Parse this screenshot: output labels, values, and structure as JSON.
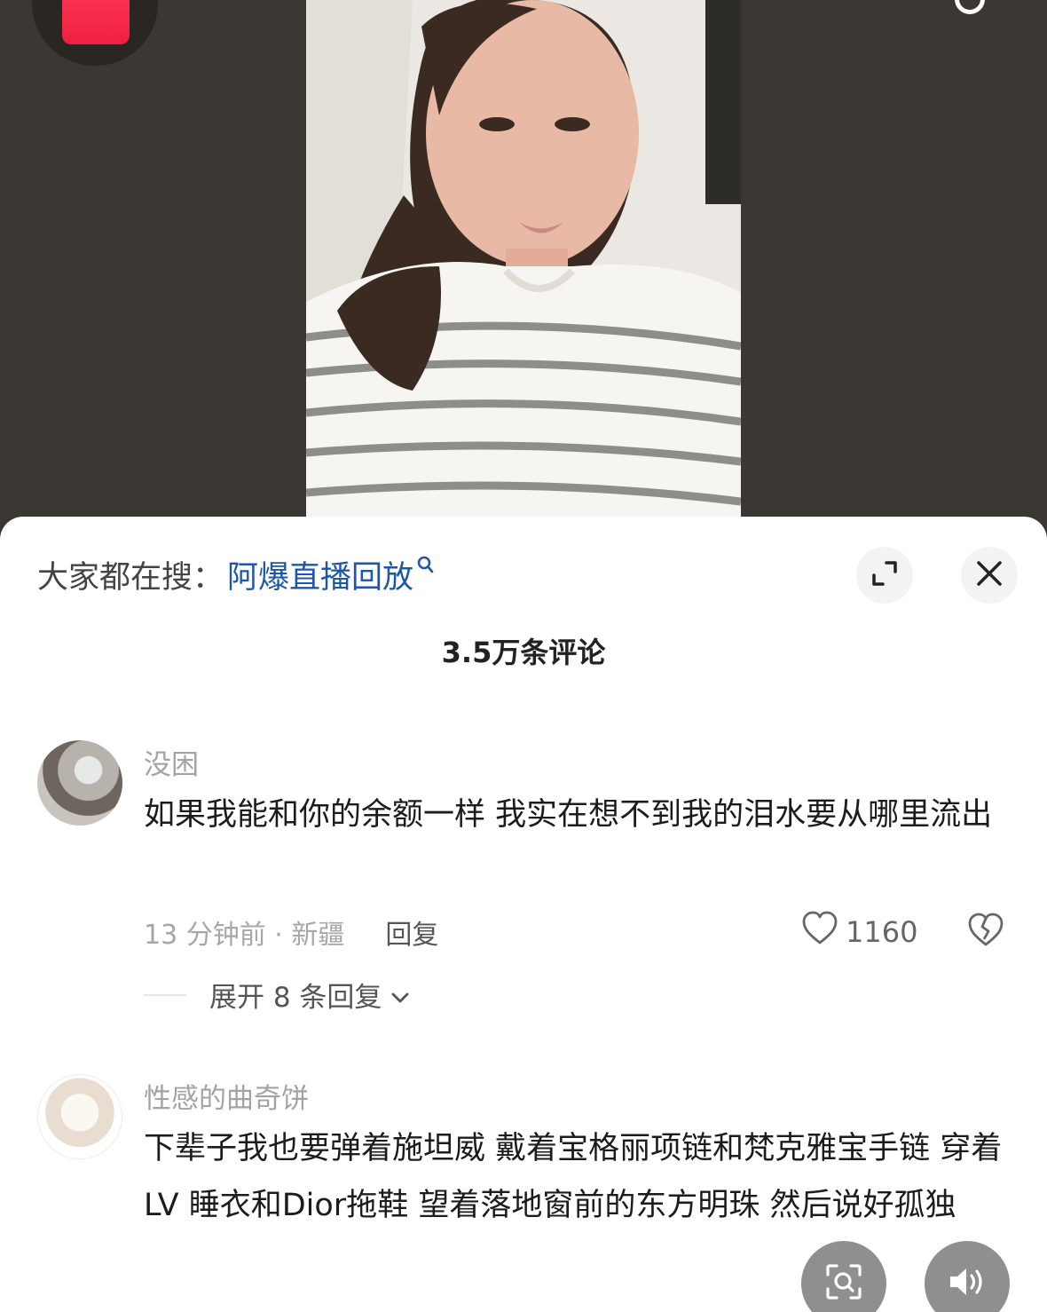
{
  "trending": {
    "prefix": "大家都在搜：",
    "keyword": "阿爆直播回放"
  },
  "comments_header": {
    "count_label": "3.5万条评论"
  },
  "comments": [
    {
      "username": "没困",
      "text": "如果我能和你的余额一样 我实在想不到我的泪水要从哪里流出",
      "meta": "13 分钟前 · 新疆",
      "reply_label": "回复",
      "likes": "1160",
      "expand_label": "展开 8 条回复"
    },
    {
      "username": "性感的曲奇饼",
      "text": "下辈子我也要弹着施坦威 戴着宝格丽项链和梵克雅宝手链 穿着LV 睡衣和Dior拖鞋  望着落地窗前的东方明珠 然后说好孤独"
    }
  ],
  "icons": {
    "search": "search-icon",
    "expand": "expand-icon",
    "close": "close-icon",
    "heart": "heart-icon",
    "broken_heart": "broken-heart-icon",
    "chevron": "chevron-down-icon",
    "image_search": "image-search-icon",
    "volume": "volume-icon"
  },
  "colors": {
    "accent_link": "#1f57a8",
    "red_envelope": "#f0203f"
  }
}
